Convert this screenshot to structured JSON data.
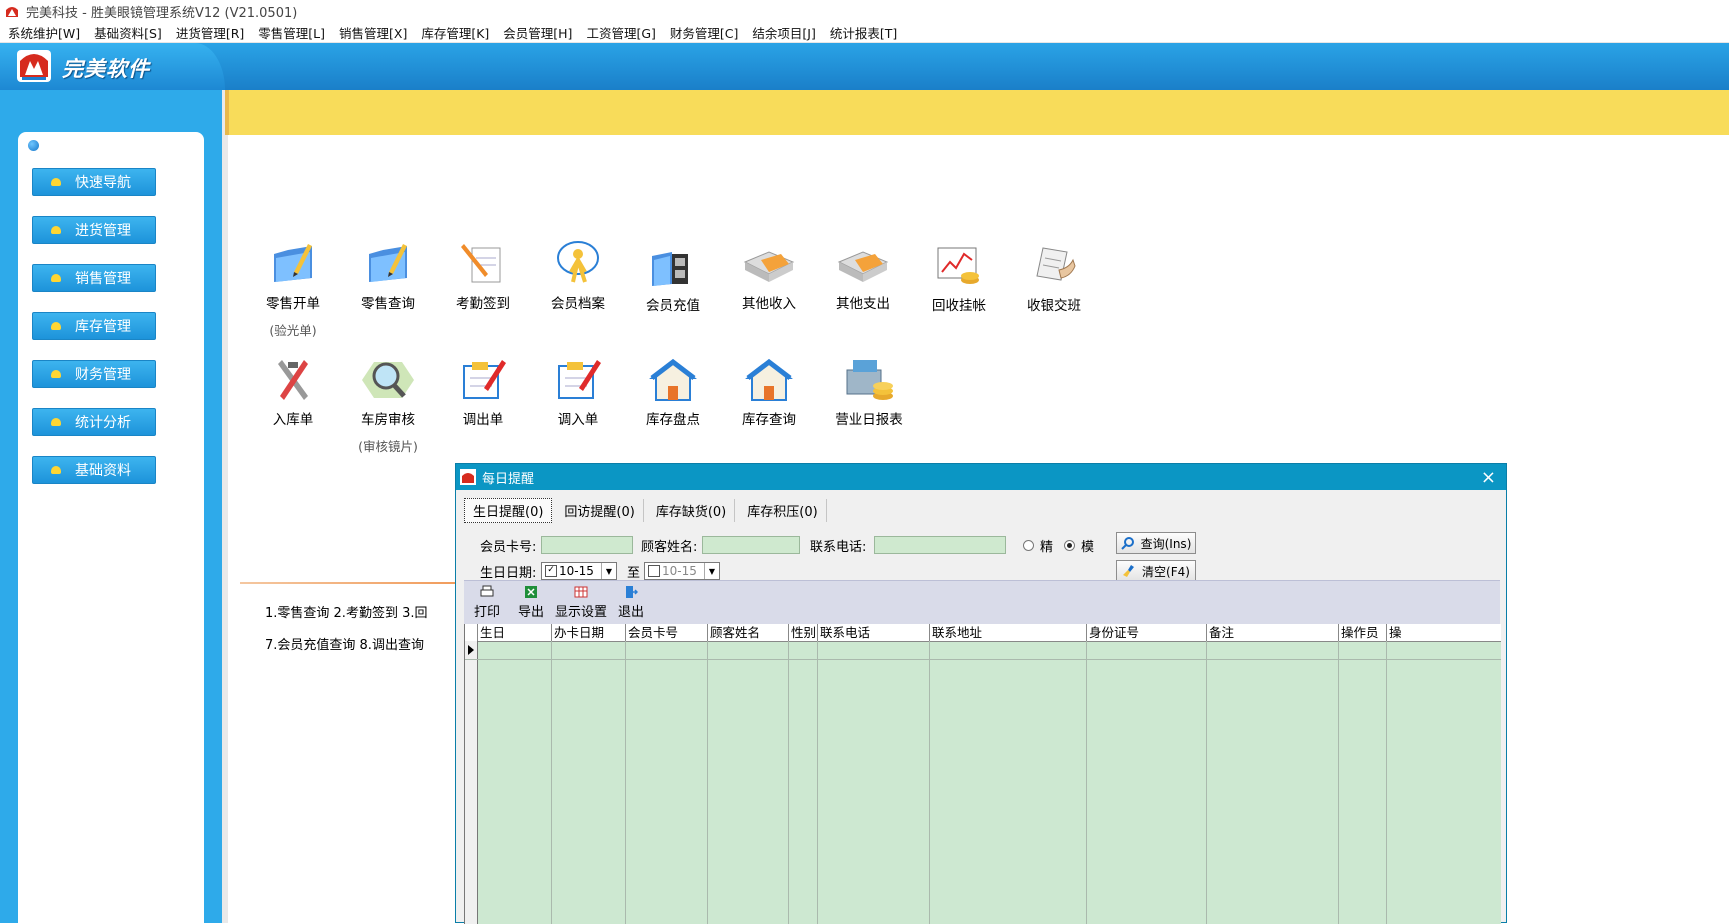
{
  "window": {
    "title": "完美科技 - 胜美眼镜管理系统V12   (V21.0501)"
  },
  "menu": [
    "系统维护[W]",
    "基础资料[S]",
    "进货管理[R]",
    "零售管理[L]",
    "销售管理[X]",
    "库存管理[K]",
    "会员管理[H]",
    "工资管理[G]",
    "财务管理[C]",
    "结余项目[J]",
    "统计报表[T]"
  ],
  "header": {
    "logo_text": "完美软件"
  },
  "sidebar": {
    "items": [
      "快速导航",
      "进货管理",
      "销售管理",
      "库存管理",
      "财务管理",
      "统计分析",
      "基础资料"
    ]
  },
  "icons_row1": [
    {
      "label": "零售开单",
      "sub": "(验光单)",
      "icon": "folder-pen-icon"
    },
    {
      "label": "零售查询",
      "sub": "",
      "icon": "folder-pen-icon"
    },
    {
      "label": "考勤签到",
      "sub": "",
      "icon": "pencil-note-icon"
    },
    {
      "label": "会员档案",
      "sub": "",
      "icon": "member-icon"
    },
    {
      "label": "会员充值",
      "sub": "",
      "icon": "folder-card-icon"
    },
    {
      "label": "其他收入",
      "sub": "",
      "icon": "money-box-icon"
    },
    {
      "label": "其他支出",
      "sub": "",
      "icon": "money-box-icon"
    },
    {
      "label": "回收挂帐",
      "sub": "",
      "icon": "chart-coins-icon"
    },
    {
      "label": "收银交班",
      "sub": "",
      "icon": "handover-icon"
    }
  ],
  "icons_row2": [
    {
      "label": "入库单",
      "sub": "",
      "icon": "tools-icon"
    },
    {
      "label": "车房审核",
      "sub": "(审核镜片)",
      "icon": "magnifier-icon"
    },
    {
      "label": "调出单",
      "sub": "",
      "icon": "clipboard-pen-icon"
    },
    {
      "label": "调入单",
      "sub": "",
      "icon": "clipboard-pen-icon"
    },
    {
      "label": "库存盘点",
      "sub": "",
      "icon": "house-icon"
    },
    {
      "label": "库存查询",
      "sub": "",
      "icon": "house-icon"
    },
    {
      "label": "营业日报表",
      "sub": "",
      "icon": "register-icon"
    }
  ],
  "quick_links": {
    "line1": "1.零售查询   2.考勤签到   3.回",
    "line2": "7.会员充值查询   8.调出查询"
  },
  "dialog": {
    "title": "每日提醒",
    "close": "×",
    "tabs": [
      "生日提醒(0)",
      "回访提醒(0)",
      "库存缺货(0)",
      "库存积压(0)"
    ],
    "form": {
      "card_label": "会员卡号:",
      "card_value": "",
      "name_label": "顾客姓名:",
      "name_value": "",
      "phone_label": "联系电话:",
      "phone_value": "",
      "radio_exact": "精",
      "radio_fuzzy": "模",
      "birthday_label": "生日日期:",
      "date_from": "10-15",
      "date_to_label": "至",
      "date_to": "10-15",
      "query_btn": "查询(Ins)",
      "clear_btn": "清空(F4)"
    },
    "toolbar": [
      "打印",
      "导出",
      "显示设置",
      "退出"
    ],
    "columns": [
      "生日",
      "办卡日期",
      "会员卡号",
      "顾客姓名",
      "性别",
      "联系电话",
      "联系地址",
      "身份证号",
      "备注",
      "操作员",
      "操"
    ]
  }
}
